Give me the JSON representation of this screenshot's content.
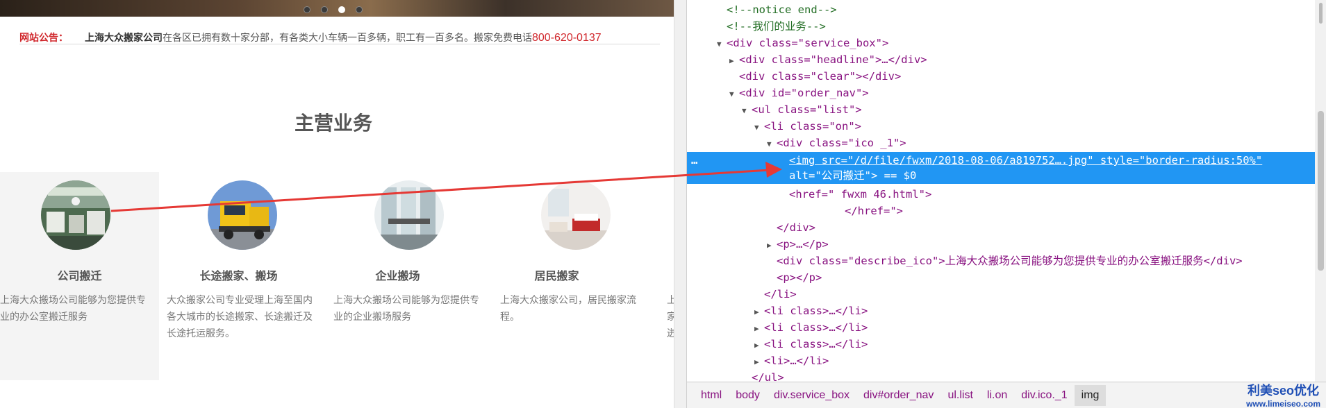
{
  "site": {
    "notice": {
      "label": "网站公告：",
      "company": "上海大众搬家公司",
      "text": "在各区已拥有数十家分部，有各类大小车辆一百多辆，职工有一百多名。搬家免费电话",
      "phone": "800-620-0137"
    },
    "section_title": "主营业务",
    "services": [
      {
        "name": "公司搬迁",
        "desc": "上海大众搬场公司能够为您提供专业的办公室搬迁服务"
      },
      {
        "name": "长途搬家、搬场",
        "desc": "大众搬家公司专业受理上海至国内各大城市的长途搬家、长途搬迁及长途托运服务。"
      },
      {
        "name": "企业搬场",
        "desc": "上海大众搬场公司能够为您提供专业的企业搬场服务"
      },
      {
        "name": "居民搬家",
        "desc": "上海大众搬家公司，居民搬家流程。"
      },
      {
        "name": "",
        "desc": "上 家 迸"
      }
    ]
  },
  "devtools": {
    "lines": [
      {
        "t": "<!--notice end-->"
      },
      {
        "t": "<!--我们的业务-->"
      },
      {
        "t": "<div class=\"service_box\">"
      },
      {
        "t": "<div class=\"headline\">…</div>"
      },
      {
        "t": "<div class=\"clear\"></div>"
      },
      {
        "t": "<div id=\"order_nav\">"
      },
      {
        "t": "<ul class=\"list\">"
      },
      {
        "t": "<li class=\"on\">"
      },
      {
        "t": "<div class=\"ico _1\">"
      },
      {
        "t": "<img src=\"/d/file/fwxm/2018-08-06/a819752….jpg\" style=\"border-radius:50%\""
      },
      {
        "t": "alt=\"公司搬迁\"> == $0"
      },
      {
        "t": "<href=\" fwxm 46.html\">"
      },
      {
        "t": "</href=\">"
      },
      {
        "t": "</div>"
      },
      {
        "t": "<p>…</p>"
      },
      {
        "t": "<div class=\"describe_ico\">上海大众搬场公司能够为您提供专业的办公室搬迁服务</div>"
      },
      {
        "t": "<p></p>"
      },
      {
        "t": "</li>"
      },
      {
        "t": "<li class>…</li>"
      },
      {
        "t": "<li class>…</li>"
      },
      {
        "t": "<li class>…</li>"
      },
      {
        "t": "<li>…</li>"
      },
      {
        "t": "</ul>"
      }
    ],
    "breadcrumbs": [
      "html",
      "body",
      "div.service_box",
      "div#order_nav",
      "ul.list",
      "li.on",
      "div.ico._1",
      "img"
    ],
    "selected_marker": "…",
    "dollar_ref": "== $0"
  },
  "watermark": {
    "line1": "利美seo优化",
    "line2": "www.limeiseo.com"
  },
  "colors": {
    "selection": "#2196f3",
    "notice_red": "#d0262b",
    "arrow": "#e53935"
  }
}
